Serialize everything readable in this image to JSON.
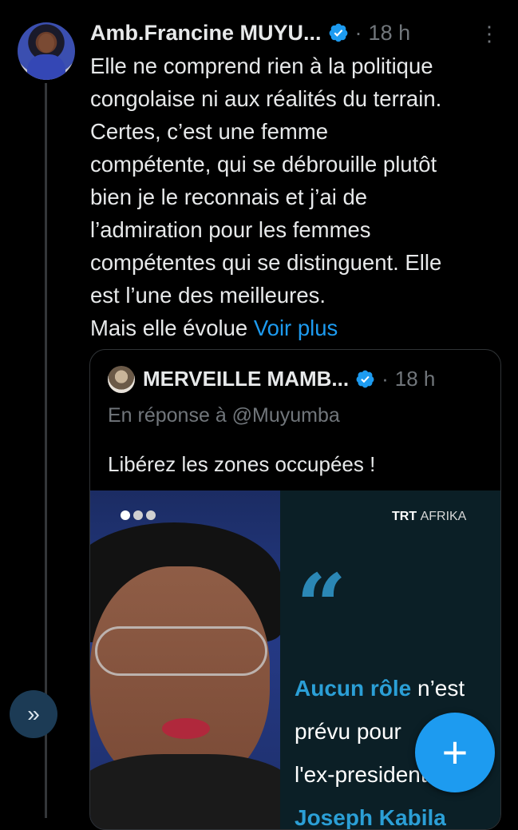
{
  "tweet": {
    "author": "Amb.Francine MUYU...",
    "separator": "·",
    "time": "18 h",
    "more_icon": "⋮",
    "lines": [
      "Elle ne comprend rien à la politique",
      "congolaise ni aux réalités du terrain.",
      "Certes, c’est une femme",
      "compétente, qui se débrouille plutôt",
      "bien je le reconnais et j’ai de",
      "l’admiration pour les femmes",
      "compétentes qui se distinguent. Elle",
      "est l’une des meilleures."
    ],
    "last_line_prefix": "Mais elle évolue",
    "see_more": "Voir plus"
  },
  "quoted": {
    "author": "MERVEILLE MAMB...",
    "separator": "·",
    "time": "18 h",
    "reply_to": "En réponse à @Muyumba",
    "text": "Libérez les zones occupées !",
    "media": {
      "brand": "TRT",
      "brand_sub": "AFRIKA",
      "quote_mark": "“",
      "line1_accent": "Aucun rôle",
      "line1_rest": " n’est",
      "line2": "prévu pour",
      "line3": "l'ex-president",
      "line4_accent": "Joseph Kabila"
    }
  },
  "ui": {
    "side_button_icon": "»",
    "compose_icon": "+",
    "colors": {
      "accent": "#1d9bf0",
      "background": "#000000",
      "text": "#e7e9ea",
      "muted": "#71767b"
    }
  }
}
